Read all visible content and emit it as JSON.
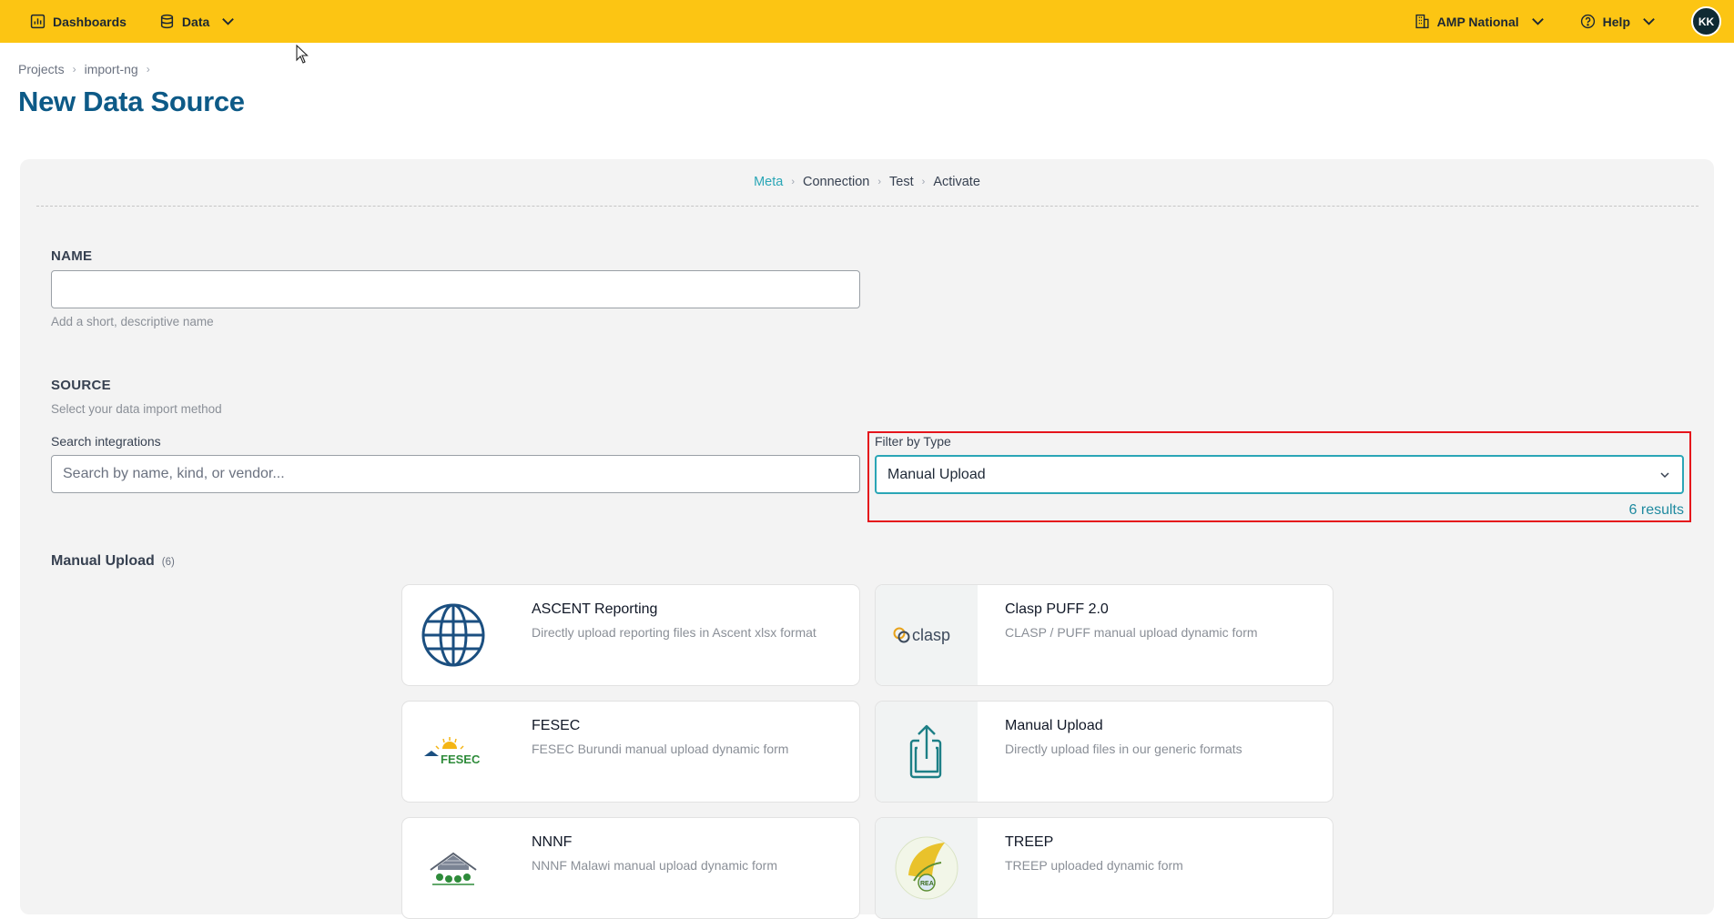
{
  "nav": {
    "dashboards": "Dashboards",
    "data": "Data",
    "org": "AMP National",
    "help": "Help",
    "avatar": "KK"
  },
  "breadcrumb": [
    "Projects",
    "import-ng"
  ],
  "page_title": "New Data Source",
  "steps": [
    "Meta",
    "Connection",
    "Test",
    "Activate"
  ],
  "name_section": {
    "label": "NAME",
    "value": "",
    "help": "Add a short, descriptive name"
  },
  "source_section": {
    "label": "SOURCE",
    "help": "Select your data import method",
    "search_label": "Search integrations",
    "search_placeholder": "Search by name, kind, or vendor...",
    "filter_label": "Filter by Type",
    "filter_value": "Manual Upload",
    "results": "6 results"
  },
  "group": {
    "title": "Manual Upload",
    "count": "(6)"
  },
  "cards": [
    {
      "name": "ASCENT Reporting",
      "desc": "Directly upload reporting files in Ascent xlsx format",
      "icon": "globe-logo"
    },
    {
      "name": "Clasp PUFF 2.0",
      "desc": "CLASP / PUFF manual upload dynamic form",
      "icon": "clasp-logo",
      "logo_text": "clasp"
    },
    {
      "name": "FESEC",
      "desc": "FESEC Burundi manual upload dynamic form",
      "icon": "fesec-logo",
      "logo_text": "FESEC"
    },
    {
      "name": "Manual Upload",
      "desc": "Directly upload files in our generic formats",
      "icon": "upload-icon"
    },
    {
      "name": "NNNF",
      "desc": "NNNF Malawi manual upload dynamic form",
      "icon": "nnnf-logo"
    },
    {
      "name": "TREEP",
      "desc": "TREEP uploaded dynamic form",
      "icon": "rea-logo",
      "logo_text": "REA"
    }
  ],
  "colors": {
    "topbar": "#fcc513",
    "title": "#0d5a87",
    "accent": "#2aa6b6",
    "highlight": "#e5141b"
  }
}
